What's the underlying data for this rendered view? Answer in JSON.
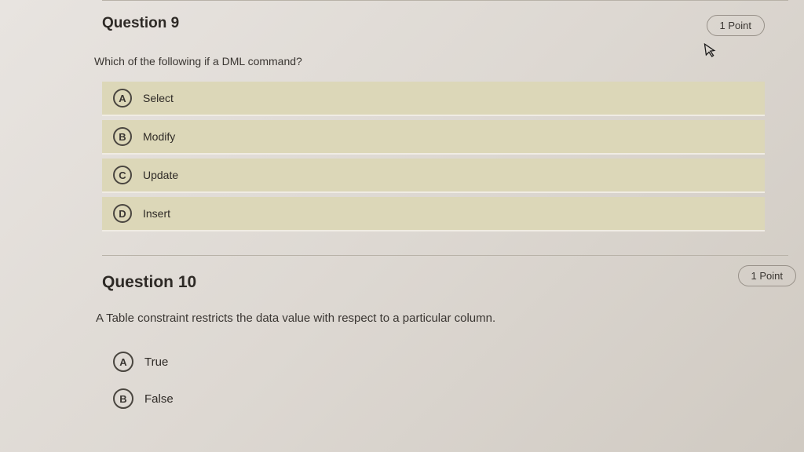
{
  "q9": {
    "title": "Question 9",
    "points": "1 Point",
    "prompt": "Which of the following if a DML command?",
    "options": [
      {
        "letter": "A",
        "text": "Select"
      },
      {
        "letter": "B",
        "text": "Modify"
      },
      {
        "letter": "C",
        "text": "Update"
      },
      {
        "letter": "D",
        "text": "Insert"
      }
    ]
  },
  "q10": {
    "title": "Question 10",
    "points": "1 Point",
    "prompt": "A Table constraint restricts the data value with respect to a particular column.",
    "options": [
      {
        "letter": "A",
        "text": "True"
      },
      {
        "letter": "B",
        "text": "False"
      }
    ]
  }
}
